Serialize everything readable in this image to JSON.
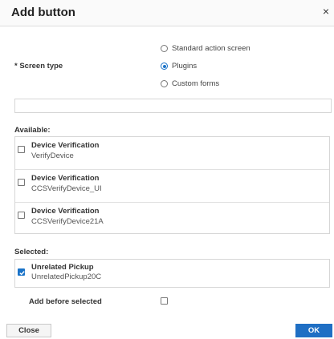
{
  "dialog": {
    "title": "Add button",
    "close_glyph": "×"
  },
  "screen_type": {
    "label": "* Screen type",
    "options": [
      {
        "label": "Standard action screen",
        "selected": false
      },
      {
        "label": "Plugins",
        "selected": true
      },
      {
        "label": "Custom forms",
        "selected": false
      }
    ]
  },
  "search": {
    "value": ""
  },
  "available": {
    "label": "Available:",
    "items": [
      {
        "title": "Device Verification",
        "subtitle": "VerifyDevice",
        "checked": false
      },
      {
        "title": "Device Verification",
        "subtitle": "CCSVerifyDevice_UI",
        "checked": false
      },
      {
        "title": "Device Verification",
        "subtitle": "CCSVerifyDevice21A",
        "checked": false
      }
    ]
  },
  "selected": {
    "label": "Selected:",
    "items": [
      {
        "title": "Unrelated Pickup",
        "subtitle": "UnrelatedPickup20C",
        "checked": true
      }
    ]
  },
  "add_before": {
    "label": "Add before selected",
    "checked": false
  },
  "footer": {
    "close_label": "Close",
    "ok_label": "OK"
  },
  "colors": {
    "accent": "#1f6fc4"
  }
}
